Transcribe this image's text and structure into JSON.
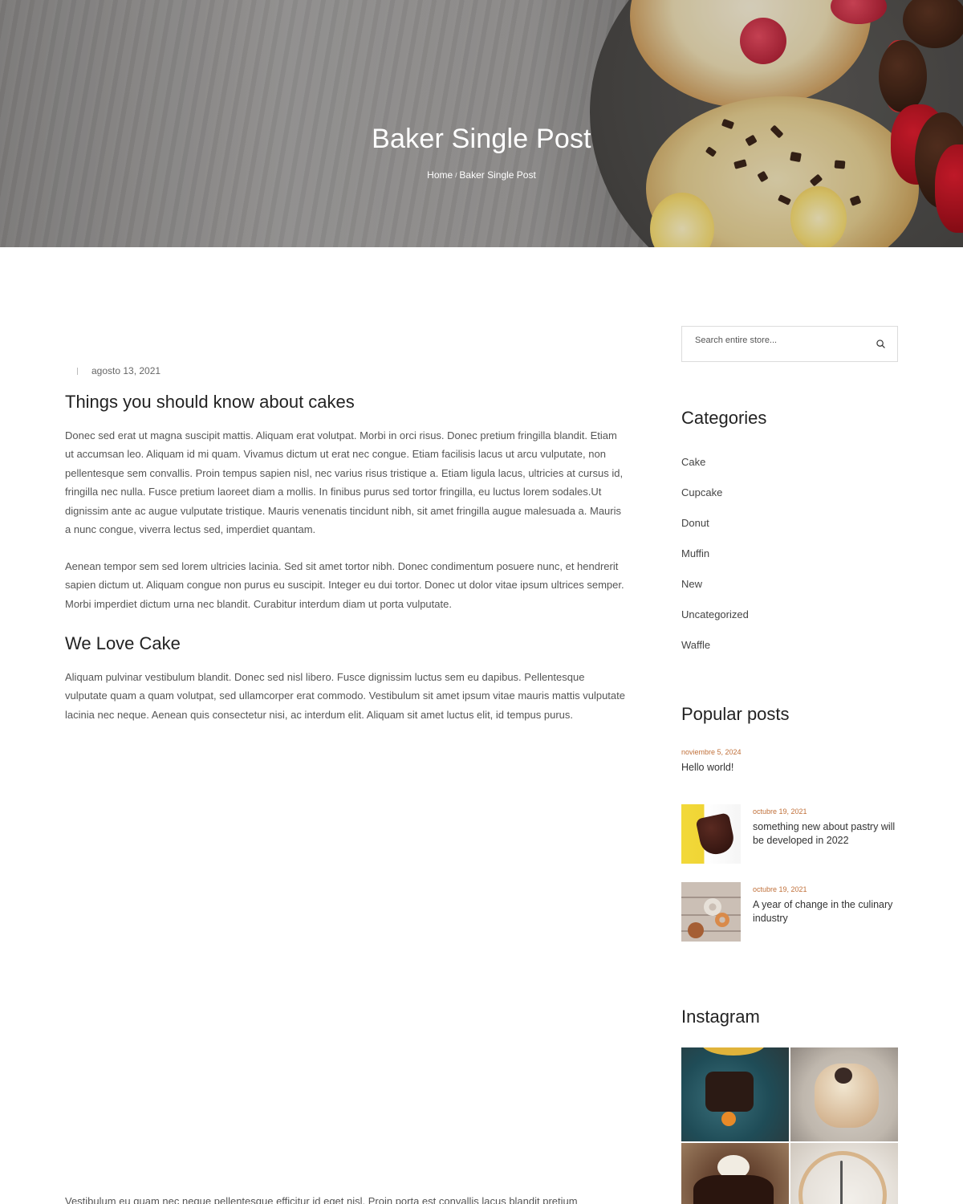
{
  "hero": {
    "title": "Baker Single Post",
    "breadcrumb": {
      "home": "Home",
      "separator": "/",
      "current": "Baker Single Post"
    }
  },
  "post": {
    "date": "agosto 13, 2021",
    "title": "Things you should know about cakes",
    "paragraph1": "Donec sed erat ut magna suscipit mattis. Aliquam erat volutpat. Morbi in orci risus. Donec pretium fringilla blandit. Etiam ut accumsan leo. Aliquam id mi quam. Vivamus dictum ut erat nec congue. Etiam facilisis lacus ut arcu vulputate, non pellentesque sem convallis. Proin tempus sapien nisl, nec varius risus tristique a. Etiam ligula lacus, ultricies at cursus id, fringilla nec nulla. Fusce pretium laoreet diam a mollis. In finibus purus sed tortor fringilla, eu luctus lorem sodales.Ut dignissim ante ac augue vulputate tristique. Mauris venenatis tincidunt nibh, sit amet fringilla augue malesuada a. Mauris a nunc congue, viverra lectus sed, imperdiet quantam.",
    "paragraph2": "Aenean tempor sem sed lorem ultricies lacinia. Sed sit amet tortor nibh. Donec condimentum posuere nunc, et hendrerit sapien dictum ut. Aliquam congue non purus eu suscipit. Integer eu dui tortor. Donec ut dolor vitae ipsum ultrices semper. Morbi imperdiet dictum urna nec blandit. Curabitur interdum diam ut porta vulputate.",
    "heading2": "We Love Cake",
    "paragraph3": "Aliquam pulvinar vestibulum blandit. Donec sed nisl libero. Fusce dignissim luctus sem eu dapibus. Pellentesque vulputate quam a quam volutpat, sed ullamcorper erat commodo. Vestibulum sit amet ipsum vitae mauris mattis vulputate lacinia nec neque. Aenean quis consectetur nisi, ac interdum elit. Aliquam sit amet luctus elit, id tempus purus.",
    "paragraph4": "Vestibulum eu quam nec neque pellentesque efficitur id eget nisl. Proin porta est convallis lacus blandit pretium"
  },
  "sidebar": {
    "search": {
      "placeholder": "Search entire store..."
    },
    "categories_title": "Categories",
    "categories": [
      "Cake",
      "Cupcake",
      "Donut",
      "Muffin",
      "New",
      "Uncategorized",
      "Waffle"
    ],
    "popular_title": "Popular posts",
    "popular": [
      {
        "date": "noviembre 5, 2024",
        "title": "Hello world!"
      },
      {
        "date": "octubre 19, 2021",
        "title": "something new about pastry will be developed in 2022"
      },
      {
        "date": "octubre 19, 2021",
        "title": "A year of change in the culinary industry"
      }
    ],
    "instagram_title": "Instagram"
  },
  "colors": {
    "accent_date": "#c0703a",
    "text_body": "#555555",
    "heading": "#222222"
  },
  "icons": {
    "search": "search-icon"
  }
}
